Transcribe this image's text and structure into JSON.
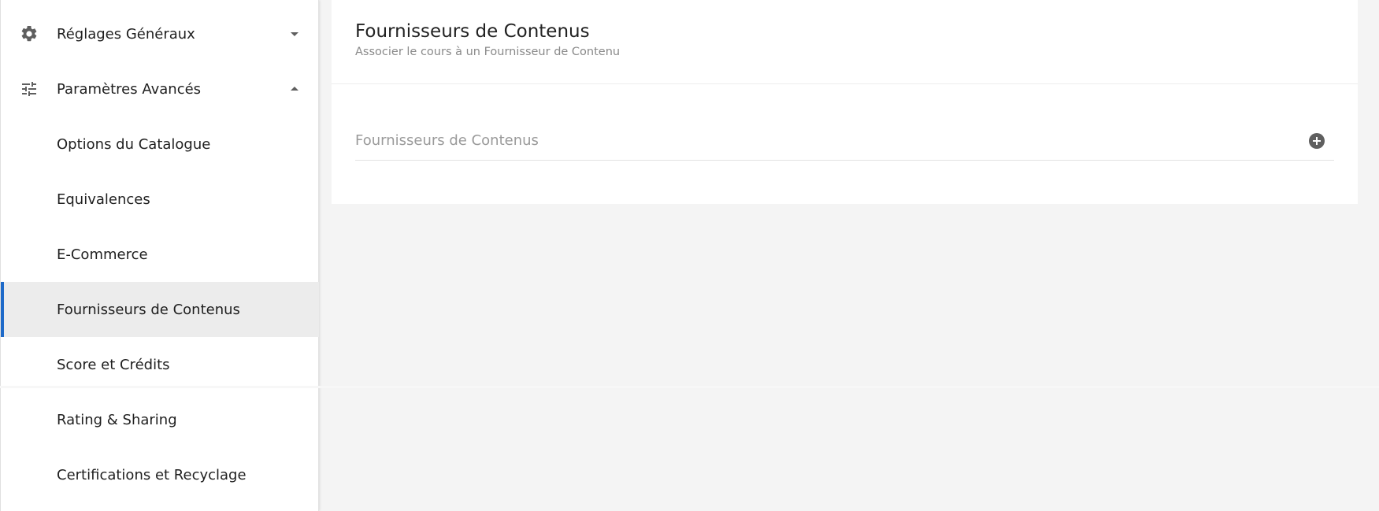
{
  "sidebar": {
    "items": [
      {
        "label": "Réglages Généraux",
        "icon": "gear-icon",
        "chevron": "down"
      },
      {
        "label": "Paramètres Avancés",
        "icon": "sliders-icon",
        "chevron": "up"
      },
      {
        "label": "Options du Catalogue"
      },
      {
        "label": "Equivalences"
      },
      {
        "label": "E-Commerce"
      },
      {
        "label": "Fournisseurs de Contenus",
        "active": true
      },
      {
        "label": "Score et Crédits"
      },
      {
        "label": "Rating & Sharing"
      },
      {
        "label": "Certifications et Recyclage"
      }
    ]
  },
  "main": {
    "title": "Fournisseurs de Contenus",
    "subtitle": "Associer le cours à un Fournisseur de Contenu",
    "field": {
      "label": "Fournisseurs de Contenus",
      "action_icon": "plus-circle-icon"
    }
  },
  "colors": {
    "accent": "#1e6ac9",
    "active_bg": "#ececec",
    "page_bg": "#f4f4f4",
    "icon": "#5f5f5f"
  }
}
